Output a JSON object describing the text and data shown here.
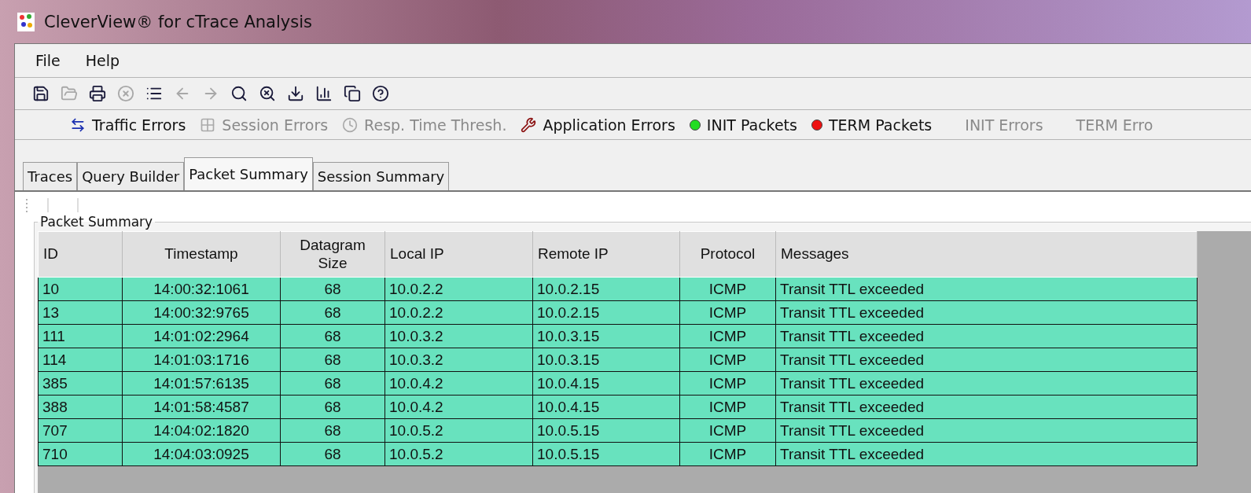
{
  "window": {
    "title": "CleverView® for cTrace Analysis"
  },
  "menu": [
    "File",
    "Help"
  ],
  "toolbar": [
    {
      "disabled": false
    },
    {
      "disabled": true
    },
    {
      "disabled": false
    },
    {
      "disabled": true
    },
    {
      "disabled": false
    },
    {
      "disabled": true
    },
    {
      "disabled": true
    },
    {
      "disabled": false
    },
    {
      "disabled": false
    },
    {
      "disabled": false
    },
    {
      "disabled": false
    },
    {
      "disabled": false
    },
    {
      "disabled": false
    }
  ],
  "filters": [
    {
      "kind": "icon",
      "label": "Traffic Errors",
      "disabled": false
    },
    {
      "kind": "icon",
      "label": "Session Errors",
      "disabled": true
    },
    {
      "kind": "icon",
      "label": "Resp. Time Thresh.",
      "disabled": true
    },
    {
      "kind": "icon",
      "label": "Application Errors",
      "disabled": false
    },
    {
      "kind": "dot",
      "color": "#22dd22",
      "label": "INIT Packets",
      "disabled": false
    },
    {
      "kind": "dot",
      "color": "#ee1111",
      "label": "TERM Packets",
      "disabled": false
    },
    {
      "kind": "plain",
      "label": "INIT Errors",
      "disabled": true
    },
    {
      "kind": "plain",
      "label": "TERM Erro",
      "disabled": true
    }
  ],
  "tabs": [
    {
      "label": "Traces",
      "selected": false
    },
    {
      "label": "Query Builder",
      "selected": false
    },
    {
      "label": "Packet Summary",
      "selected": true
    },
    {
      "label": "Session Summary",
      "selected": false
    }
  ],
  "panel": {
    "title": "Packet Summary"
  },
  "table": {
    "columns": [
      "ID",
      "Timestamp",
      "Datagram Size",
      "Local IP",
      "Remote IP",
      "Protocol",
      "Messages"
    ],
    "rows": [
      [
        "10",
        "14:00:32:1061",
        "68",
        "10.0.2.2",
        "10.0.2.15",
        "ICMP",
        "Transit TTL exceeded"
      ],
      [
        "13",
        "14:00:32:9765",
        "68",
        "10.0.2.2",
        "10.0.2.15",
        "ICMP",
        "Transit TTL exceeded"
      ],
      [
        "111",
        "14:01:02:2964",
        "68",
        "10.0.3.2",
        "10.0.3.15",
        "ICMP",
        "Transit TTL exceeded"
      ],
      [
        "114",
        "14:01:03:1716",
        "68",
        "10.0.3.2",
        "10.0.3.15",
        "ICMP",
        "Transit TTL exceeded"
      ],
      [
        "385",
        "14:01:57:6135",
        "68",
        "10.0.4.2",
        "10.0.4.15",
        "ICMP",
        "Transit TTL exceeded"
      ],
      [
        "388",
        "14:01:58:4587",
        "68",
        "10.0.4.2",
        "10.0.4.15",
        "ICMP",
        "Transit TTL exceeded"
      ],
      [
        "707",
        "14:04:02:1820",
        "68",
        "10.0.5.2",
        "10.0.5.15",
        "ICMP",
        "Transit TTL exceeded"
      ],
      [
        "710",
        "14:04:03:0925",
        "68",
        "10.0.5.2",
        "10.0.5.15",
        "ICMP",
        "Transit TTL exceeded"
      ]
    ]
  }
}
